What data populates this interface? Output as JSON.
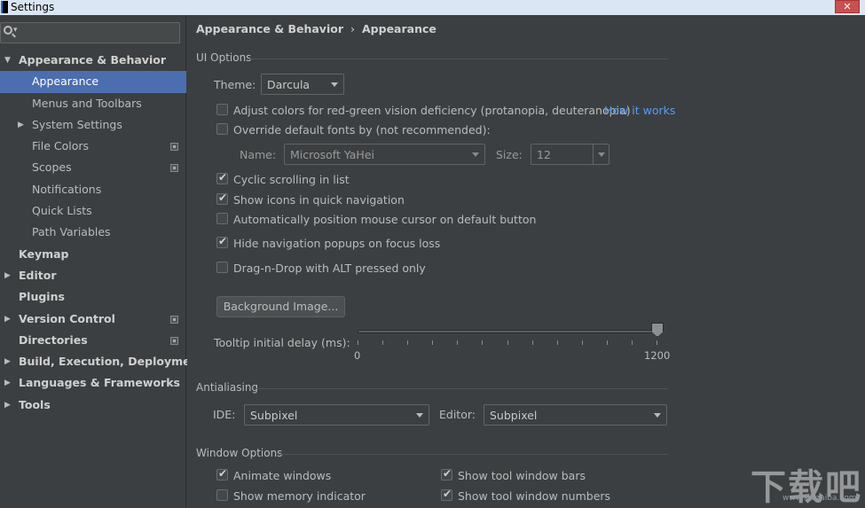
{
  "window": {
    "title": "Settings",
    "close_glyph": "✕"
  },
  "sidebar": {
    "search": {
      "placeholder": "",
      "icon": "search-icon"
    },
    "items": [
      {
        "label": "Appearance & Behavior",
        "level": 0,
        "expanded": true,
        "bold": true,
        "arrow": "▼"
      },
      {
        "label": "Appearance",
        "level": 1,
        "selected": true
      },
      {
        "label": "Menus and Toolbars",
        "level": 1
      },
      {
        "label": "System Settings",
        "level": 1,
        "arrow": "▶"
      },
      {
        "label": "File Colors",
        "level": 1,
        "project": true
      },
      {
        "label": "Scopes",
        "level": 1,
        "project": true
      },
      {
        "label": "Notifications",
        "level": 1
      },
      {
        "label": "Quick Lists",
        "level": 1
      },
      {
        "label": "Path Variables",
        "level": 1
      },
      {
        "label": "Keymap",
        "level": 0,
        "bold": true
      },
      {
        "label": "Editor",
        "level": 0,
        "bold": true,
        "arrow": "▶"
      },
      {
        "label": "Plugins",
        "level": 0,
        "bold": true
      },
      {
        "label": "Version Control",
        "level": 0,
        "bold": true,
        "arrow": "▶",
        "project": true
      },
      {
        "label": "Directories",
        "level": 0,
        "bold": true,
        "project": true
      },
      {
        "label": "Build, Execution, Deployment",
        "level": 0,
        "bold": true,
        "arrow": "▶"
      },
      {
        "label": "Languages & Frameworks",
        "level": 0,
        "bold": true,
        "arrow": "▶"
      },
      {
        "label": "Tools",
        "level": 0,
        "bold": true,
        "arrow": "▶"
      }
    ]
  },
  "breadcrumb": {
    "parent": "Appearance & Behavior",
    "separator": "›",
    "current": "Appearance"
  },
  "ui_options": {
    "title": "UI Options",
    "theme_label": "Theme:",
    "theme_value": "Darcula",
    "adjust_colors": {
      "label": "Adjust colors for red-green vision deficiency (protanopia, deuteranopia)",
      "checked": false,
      "link": "How it works"
    },
    "override_fonts": {
      "label": "Override default fonts by (not recommended):",
      "checked": false
    },
    "font_name_label": "Name:",
    "font_name_value": "Microsoft YaHei",
    "font_size_label": "Size:",
    "font_size_value": "12",
    "checkboxes": [
      {
        "label": "Cyclic scrolling in list",
        "checked": true
      },
      {
        "label": "Show icons in quick navigation",
        "checked": true
      },
      {
        "label": "Automatically position mouse cursor on default button",
        "checked": false
      },
      {
        "label": "Hide navigation popups on focus loss",
        "checked": true
      },
      {
        "label": "Drag-n-Drop with ALT pressed only",
        "checked": false
      }
    ],
    "background_button": "Background Image...",
    "tooltip_label": "Tooltip initial delay (ms):",
    "tooltip_min": "0",
    "tooltip_max": "1200",
    "tooltip_value": 1200
  },
  "antialiasing": {
    "title": "Antialiasing",
    "ide_label": "IDE:",
    "ide_value": "Subpixel",
    "editor_label": "Editor:",
    "editor_value": "Subpixel"
  },
  "window_options": {
    "title": "Window Options",
    "left": [
      {
        "label": "Animate windows",
        "checked": true
      },
      {
        "label": "Show memory indicator",
        "checked": false
      }
    ],
    "right": [
      {
        "label": "Show tool window bars",
        "checked": true
      },
      {
        "label": "Show tool window numbers",
        "checked": true
      }
    ]
  },
  "watermark": {
    "text": "下载吧",
    "url": "www.xiazaiba.com"
  }
}
